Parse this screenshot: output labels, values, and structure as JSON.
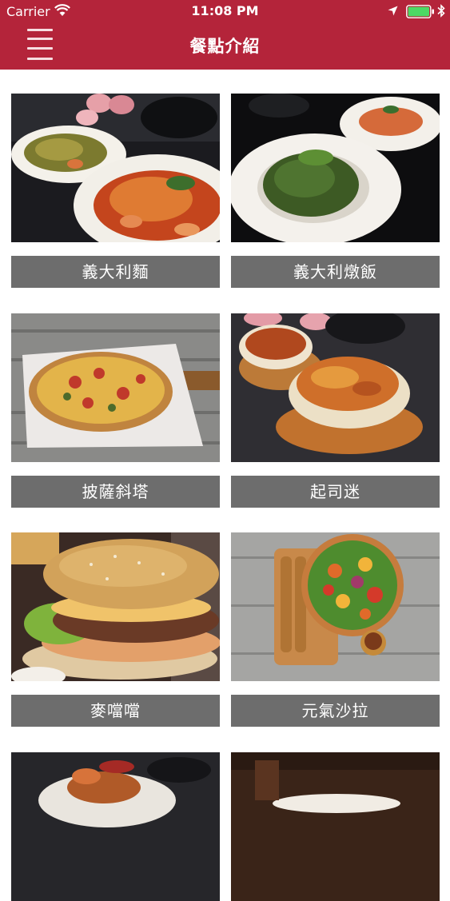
{
  "status_bar": {
    "carrier": "Carrier",
    "time": "11:08 PM"
  },
  "header": {
    "title": "餐點介紹",
    "background_color": "#b4243a"
  },
  "menu_items": [
    {
      "label": "義大利麵"
    },
    {
      "label": "義大利燉飯"
    },
    {
      "label": "披薩斜塔"
    },
    {
      "label": "起司迷"
    },
    {
      "label": "麥噹噹"
    },
    {
      "label": "元氣沙拉"
    }
  ],
  "colors": {
    "label_background": "#6d6d6d",
    "label_text": "#ffffff"
  }
}
